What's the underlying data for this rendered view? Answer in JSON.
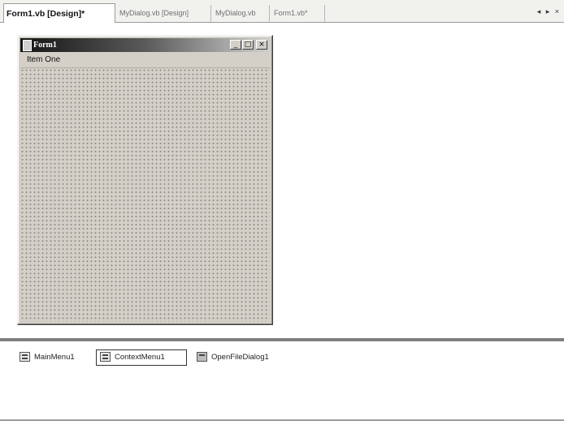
{
  "tabs": [
    {
      "label": "Form1.vb [Design]*",
      "active": true
    },
    {
      "label": "MyDialog.vb [Design]",
      "active": false
    },
    {
      "label": "MyDialog.vb",
      "active": false
    },
    {
      "label": "Form1.vb*",
      "active": false
    }
  ],
  "tab_nav": {
    "arrows": "◂ ▸ ×"
  },
  "form": {
    "title": "Form1",
    "controls": {
      "minimize": "_",
      "maximize": "□",
      "close": "×"
    },
    "menu_items": [
      "Item One"
    ]
  },
  "tray": {
    "components": [
      {
        "label": "MainMenu1",
        "icon": "main-menu-icon",
        "selected": false
      },
      {
        "label": "ContextMenu1",
        "icon": "context-menu-icon",
        "selected": true
      },
      {
        "label": "OpenFileDialog1",
        "icon": "open-file-dialog-icon",
        "selected": false
      }
    ]
  }
}
